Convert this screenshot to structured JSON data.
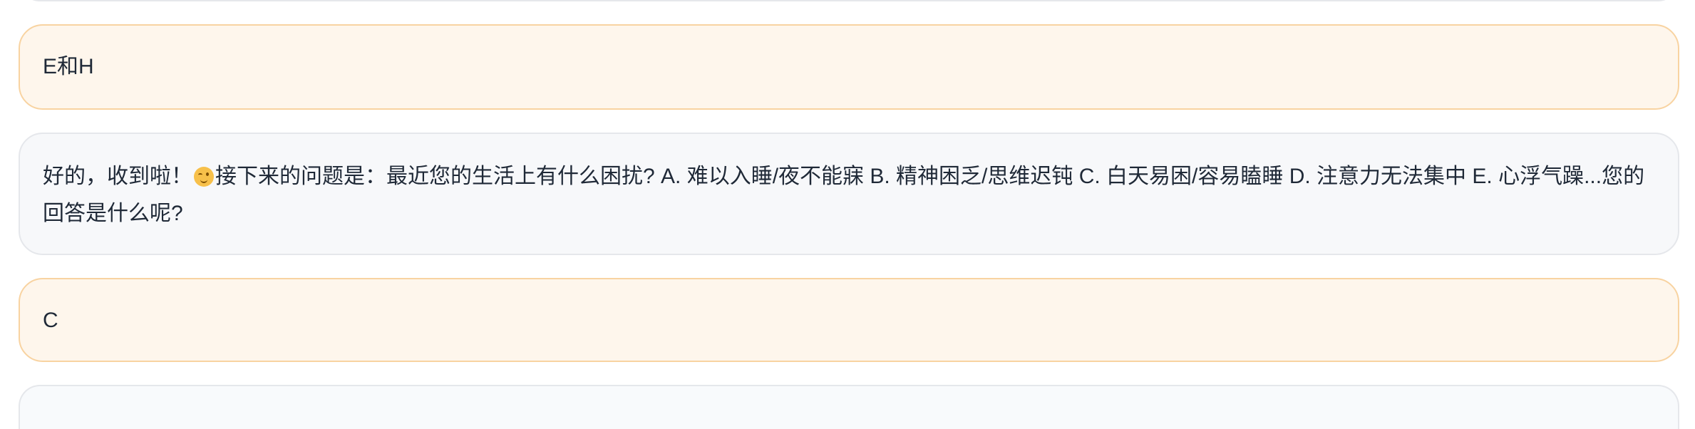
{
  "messages": [
    {
      "role": "user",
      "text": "E和H"
    },
    {
      "role": "assistant",
      "text_before_emoji": "好的，收到啦！",
      "emoji": "wink-emoji",
      "text_after_emoji": "接下来的问题是：最近您的生活上有什么困扰? A. 难以入睡/夜不能寐 B. 精神困乏/思维迟钝 C. 白天易困/容易瞌睡 D. 注意力无法集中 E. 心浮气躁...您的回答是什么呢?"
    },
    {
      "role": "user",
      "text": "C"
    }
  ],
  "colors": {
    "user_bubble_bg": "#fef6ec",
    "user_bubble_border": "#f8d3a1",
    "assistant_bubble_bg": "#f7f8fa",
    "assistant_bubble_border": "#e5e7eb"
  }
}
